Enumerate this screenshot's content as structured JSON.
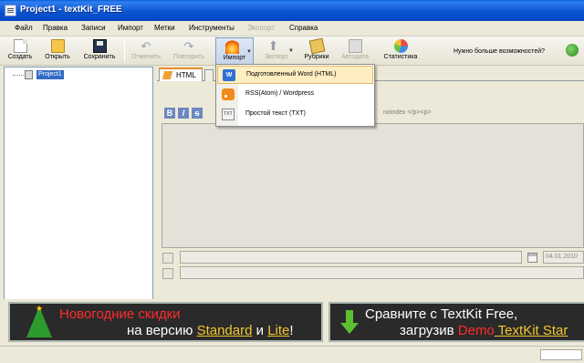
{
  "window": {
    "title": "Project1 - textKit_FREE"
  },
  "menu": {
    "items": [
      {
        "label": "Файл",
        "enabled": true
      },
      {
        "label": "Правка",
        "enabled": true
      },
      {
        "label": "Записи",
        "enabled": true
      },
      {
        "label": "Импорт",
        "enabled": true
      },
      {
        "label": "Метки",
        "enabled": true
      },
      {
        "label": "Инструменты",
        "enabled": true
      },
      {
        "label": "Экспорт",
        "enabled": false
      },
      {
        "label": "Справка",
        "enabled": true
      }
    ]
  },
  "toolbar": {
    "buttons": [
      {
        "label": "Создать",
        "icon": "new-document-icon",
        "enabled": true
      },
      {
        "label": "Открыть",
        "icon": "open-folder-icon",
        "enabled": true
      },
      {
        "label": "Сохранить",
        "icon": "save-disk-icon",
        "enabled": true
      },
      {
        "label": "Отменить",
        "icon": "undo-icon",
        "enabled": false
      },
      {
        "label": "Повторить",
        "icon": "redo-icon",
        "enabled": false
      },
      {
        "label": "Импорт",
        "icon": "import-flame-icon",
        "enabled": true,
        "pressed": true
      },
      {
        "label": "Экспорт",
        "icon": "export-arrow-icon",
        "enabled": false
      },
      {
        "label": "Рубрики",
        "icon": "rubrics-icon",
        "enabled": true
      },
      {
        "label": "Автодата",
        "icon": "calendar-icon",
        "enabled": false
      },
      {
        "label": "Статистика",
        "icon": "pie-chart-icon",
        "enabled": true
      }
    ],
    "more_text": "Нужно больше возможностей?"
  },
  "tree": {
    "root_label": "Project1"
  },
  "editor": {
    "tab_label": "HTML",
    "format_hint": "noindex   </p><p>",
    "date_value": "04.01.2010"
  },
  "import_menu": {
    "items": [
      {
        "label": "Подготовленный Word (HTML)",
        "icon": "word-icon",
        "highlighted": true
      },
      {
        "label": "RSS(Atom) / Wordpress",
        "icon": "rss-icon",
        "highlighted": false
      },
      {
        "label": "Простой текст (TXT)",
        "icon": "txt-file-icon",
        "highlighted": false
      }
    ],
    "word_icon_text": "W",
    "txt_icon_text": "TXT"
  },
  "banners": {
    "left": {
      "line1": "Новогодние скидки",
      "line2_prefix": "на версию ",
      "link1": "Standard",
      "middle": " и ",
      "link2": "Lite",
      "suffix": "!"
    },
    "right": {
      "line1": "Сравните с TextKit Free,",
      "line2_prefix": "загрузив ",
      "demo": "Demo",
      "link": " TextKit Star"
    }
  },
  "colors": {
    "titlebar": "#0b55d0",
    "banner_red": "#ff2b2b",
    "banner_yellow": "#f2c82e",
    "highlight": "#ffeec2",
    "selection": "#316ac5"
  }
}
